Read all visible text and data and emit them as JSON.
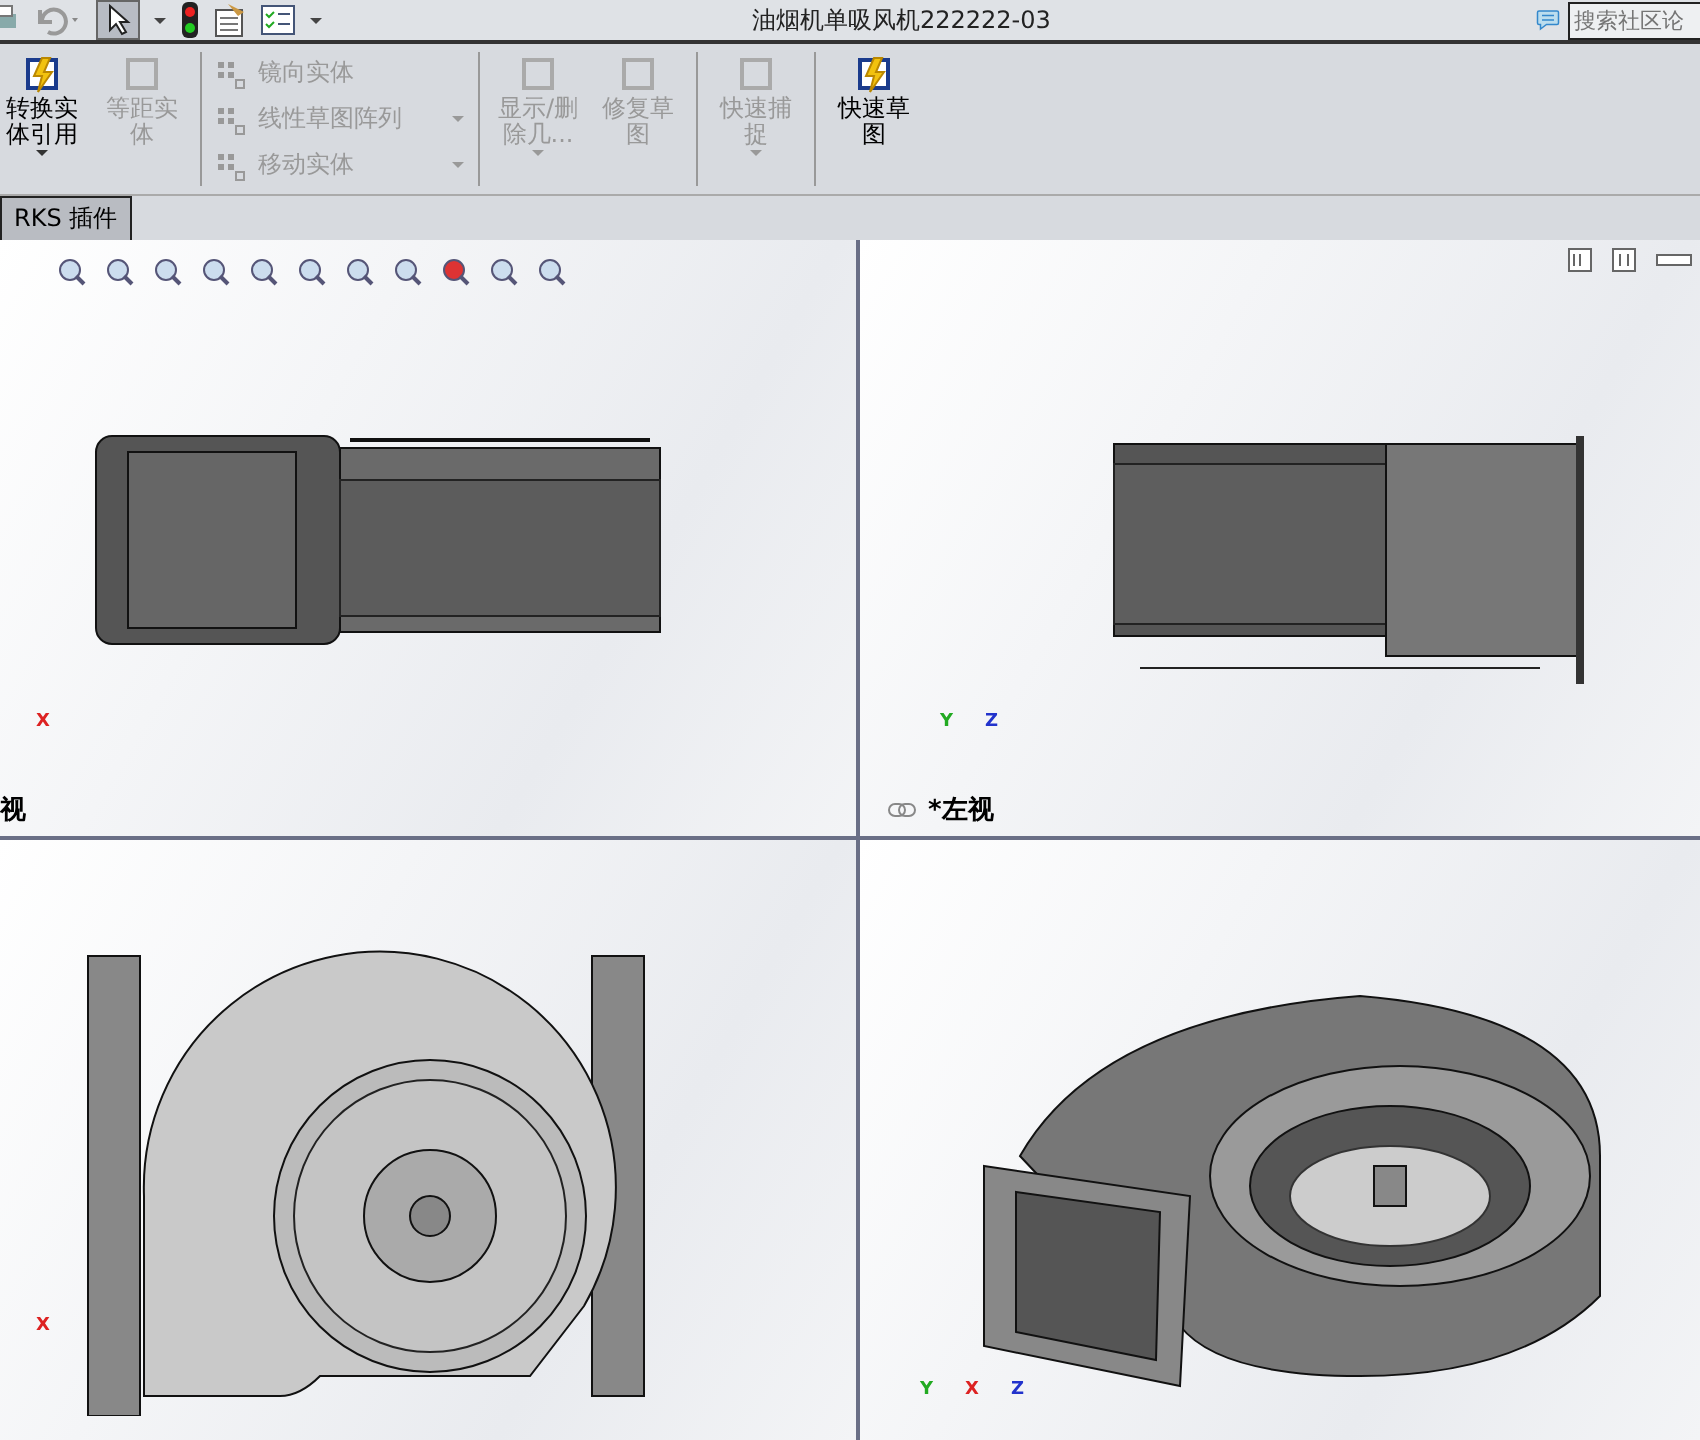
{
  "window": {
    "title": "油烟机单吸风机222222-03",
    "search": {
      "placeholder": "搜索社区论"
    }
  },
  "ribbon": {
    "groups": [
      {
        "tools": [
          {
            "label": "转换实体引用",
            "kind": "large",
            "disabled": false,
            "dropdown": true
          },
          {
            "label": "等距实体",
            "kind": "large",
            "disabled": true,
            "dropdown": false
          }
        ]
      },
      {
        "tools": [
          {
            "label": "镜向实体",
            "kind": "small",
            "disabled": true,
            "dropdown": false
          },
          {
            "label": "线性草图阵列",
            "kind": "small",
            "disabled": true,
            "dropdown": true
          },
          {
            "label": "移动实体",
            "kind": "small",
            "disabled": true,
            "dropdown": true
          }
        ]
      },
      {
        "tools": [
          {
            "label": "显示/删除几...",
            "kind": "large",
            "disabled": true,
            "dropdown": true
          },
          {
            "label": "修复草图",
            "kind": "large",
            "disabled": true,
            "dropdown": false
          }
        ]
      },
      {
        "tools": [
          {
            "label": "快速捕捉",
            "kind": "large",
            "disabled": true,
            "dropdown": true
          }
        ]
      },
      {
        "tools": [
          {
            "label": "快速草图",
            "kind": "large",
            "disabled": false,
            "dropdown": false
          }
        ]
      }
    ]
  },
  "tab": {
    "label": "RKS 插件"
  },
  "viewports": [
    {
      "kind": "front",
      "label": "视",
      "axes": [
        "X"
      ]
    },
    {
      "kind": "left",
      "label": "*左视",
      "axes": [
        "Y",
        "Z"
      ]
    },
    {
      "kind": "back",
      "axes": [
        "X"
      ]
    },
    {
      "kind": "iso",
      "axes": [
        "Y",
        "X",
        "Z"
      ]
    }
  ]
}
